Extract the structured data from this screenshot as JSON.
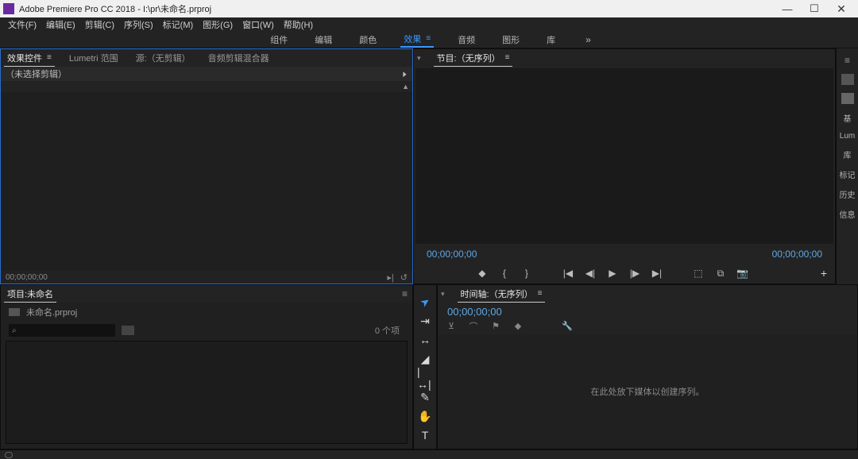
{
  "titlebar": {
    "app_name": "Adobe Premiere Pro CC 2018",
    "document": "I:\\pr\\未命名.prproj"
  },
  "menubar": {
    "items": [
      "文件(F)",
      "编辑(E)",
      "剪辑(C)",
      "序列(S)",
      "标记(M)",
      "图形(G)",
      "窗口(W)",
      "帮助(H)"
    ]
  },
  "workspaces": {
    "items": [
      "组件",
      "编辑",
      "颜色",
      "效果",
      "音频",
      "图形",
      "库"
    ],
    "active_index": 3
  },
  "effect_controls": {
    "tabs": [
      "效果控件",
      "Lumetri 范围",
      "源:（无剪辑）",
      "音频剪辑混合器"
    ],
    "active_index": 0,
    "no_selection": "（未选择剪辑）",
    "time": "00;00;00;00"
  },
  "program_monitor": {
    "title": "节目:（无序列）",
    "tc_left": "00;00;00;00",
    "tc_right": "00;00;00;00"
  },
  "side_tabs": {
    "items": [
      "基",
      "Lum",
      "库",
      "标记",
      "历史",
      "信息"
    ]
  },
  "project": {
    "title": "项目:未命名",
    "file_name": "未命名.prproj",
    "item_count": "0 个项"
  },
  "timeline": {
    "title": "时间轴:（无序列）",
    "tc": "00;00;00;00",
    "empty_hint": "在此处放下媒体以创建序列。"
  },
  "tools": {
    "items": [
      "selection",
      "track-select",
      "ripple-edit",
      "razor",
      "slip",
      "pen",
      "hand",
      "type"
    ],
    "glyphs": [
      "▲",
      "⇥",
      "↔",
      "✂",
      "|↔|",
      "✎",
      "✋",
      "T"
    ],
    "active_index": 0
  }
}
